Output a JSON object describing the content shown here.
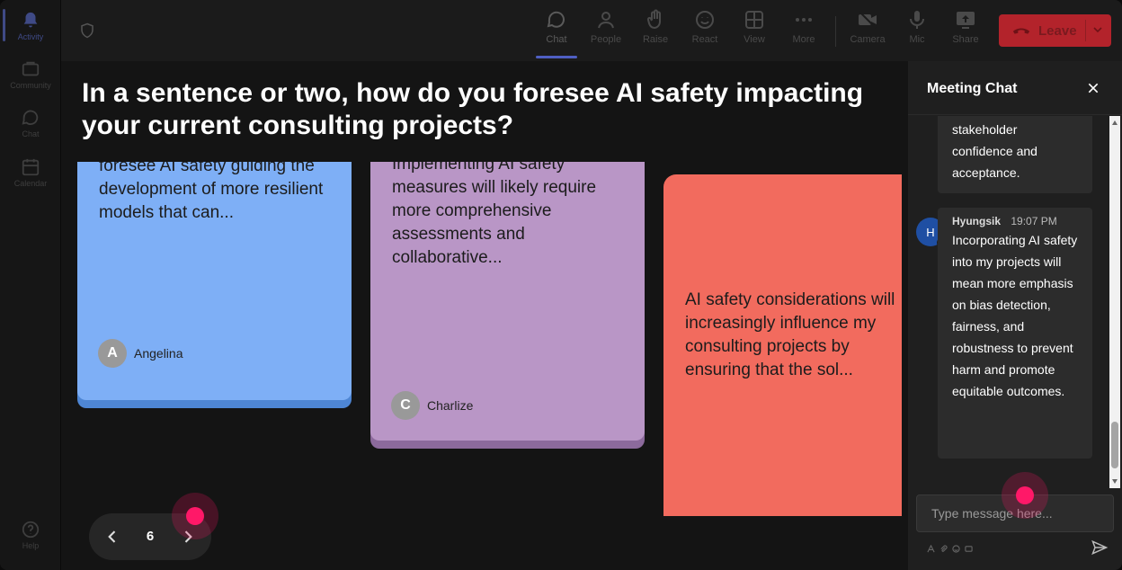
{
  "rail": {
    "items": [
      {
        "label": "Activity",
        "icon": "bell-icon"
      },
      {
        "label": "Community",
        "icon": "community-icon"
      },
      {
        "label": "Chat",
        "icon": "chat-icon"
      },
      {
        "label": "Calendar",
        "icon": "calendar-icon"
      },
      {
        "label": "Help",
        "icon": "help-icon"
      }
    ]
  },
  "toolbar": {
    "chat": "Chat",
    "people": "People",
    "raise": "Raise",
    "react": "React",
    "view": "View",
    "more": "More",
    "camera": "Camera",
    "mic": "Mic",
    "share": "Share",
    "leave": "Leave"
  },
  "stage": {
    "question": "In a sentence or two, how do you foresee AI safety impacting your current consulting projects?",
    "cards": [
      {
        "text": "foresee AI safety guiding the development of more resilient models that can...",
        "author": "Angelina",
        "initial": "A",
        "color": "#7eaff6"
      },
      {
        "text": "Implementing AI safety measures will likely require more comprehensive assessments and collaborative...",
        "author": "Charlize",
        "initial": "C",
        "color": "#b996c6"
      },
      {
        "text": "AI safety considerations will increasingly influence my consulting projects by ensuring that the sol...",
        "color": "#f26b5e"
      }
    ],
    "pager": {
      "page": "6"
    }
  },
  "chat": {
    "title": "Meeting Chat",
    "messages": [
      {
        "text": "stakeholder confidence and acceptance."
      },
      {
        "author": "Hyungsik",
        "time": "19:07 PM",
        "initial": "H",
        "text": "Incorporating AI safety into my projects will mean more emphasis on bias detection, fairness, and robustness to prevent harm and promote equitable outcomes."
      }
    ],
    "input_placeholder": "Type message here..."
  }
}
